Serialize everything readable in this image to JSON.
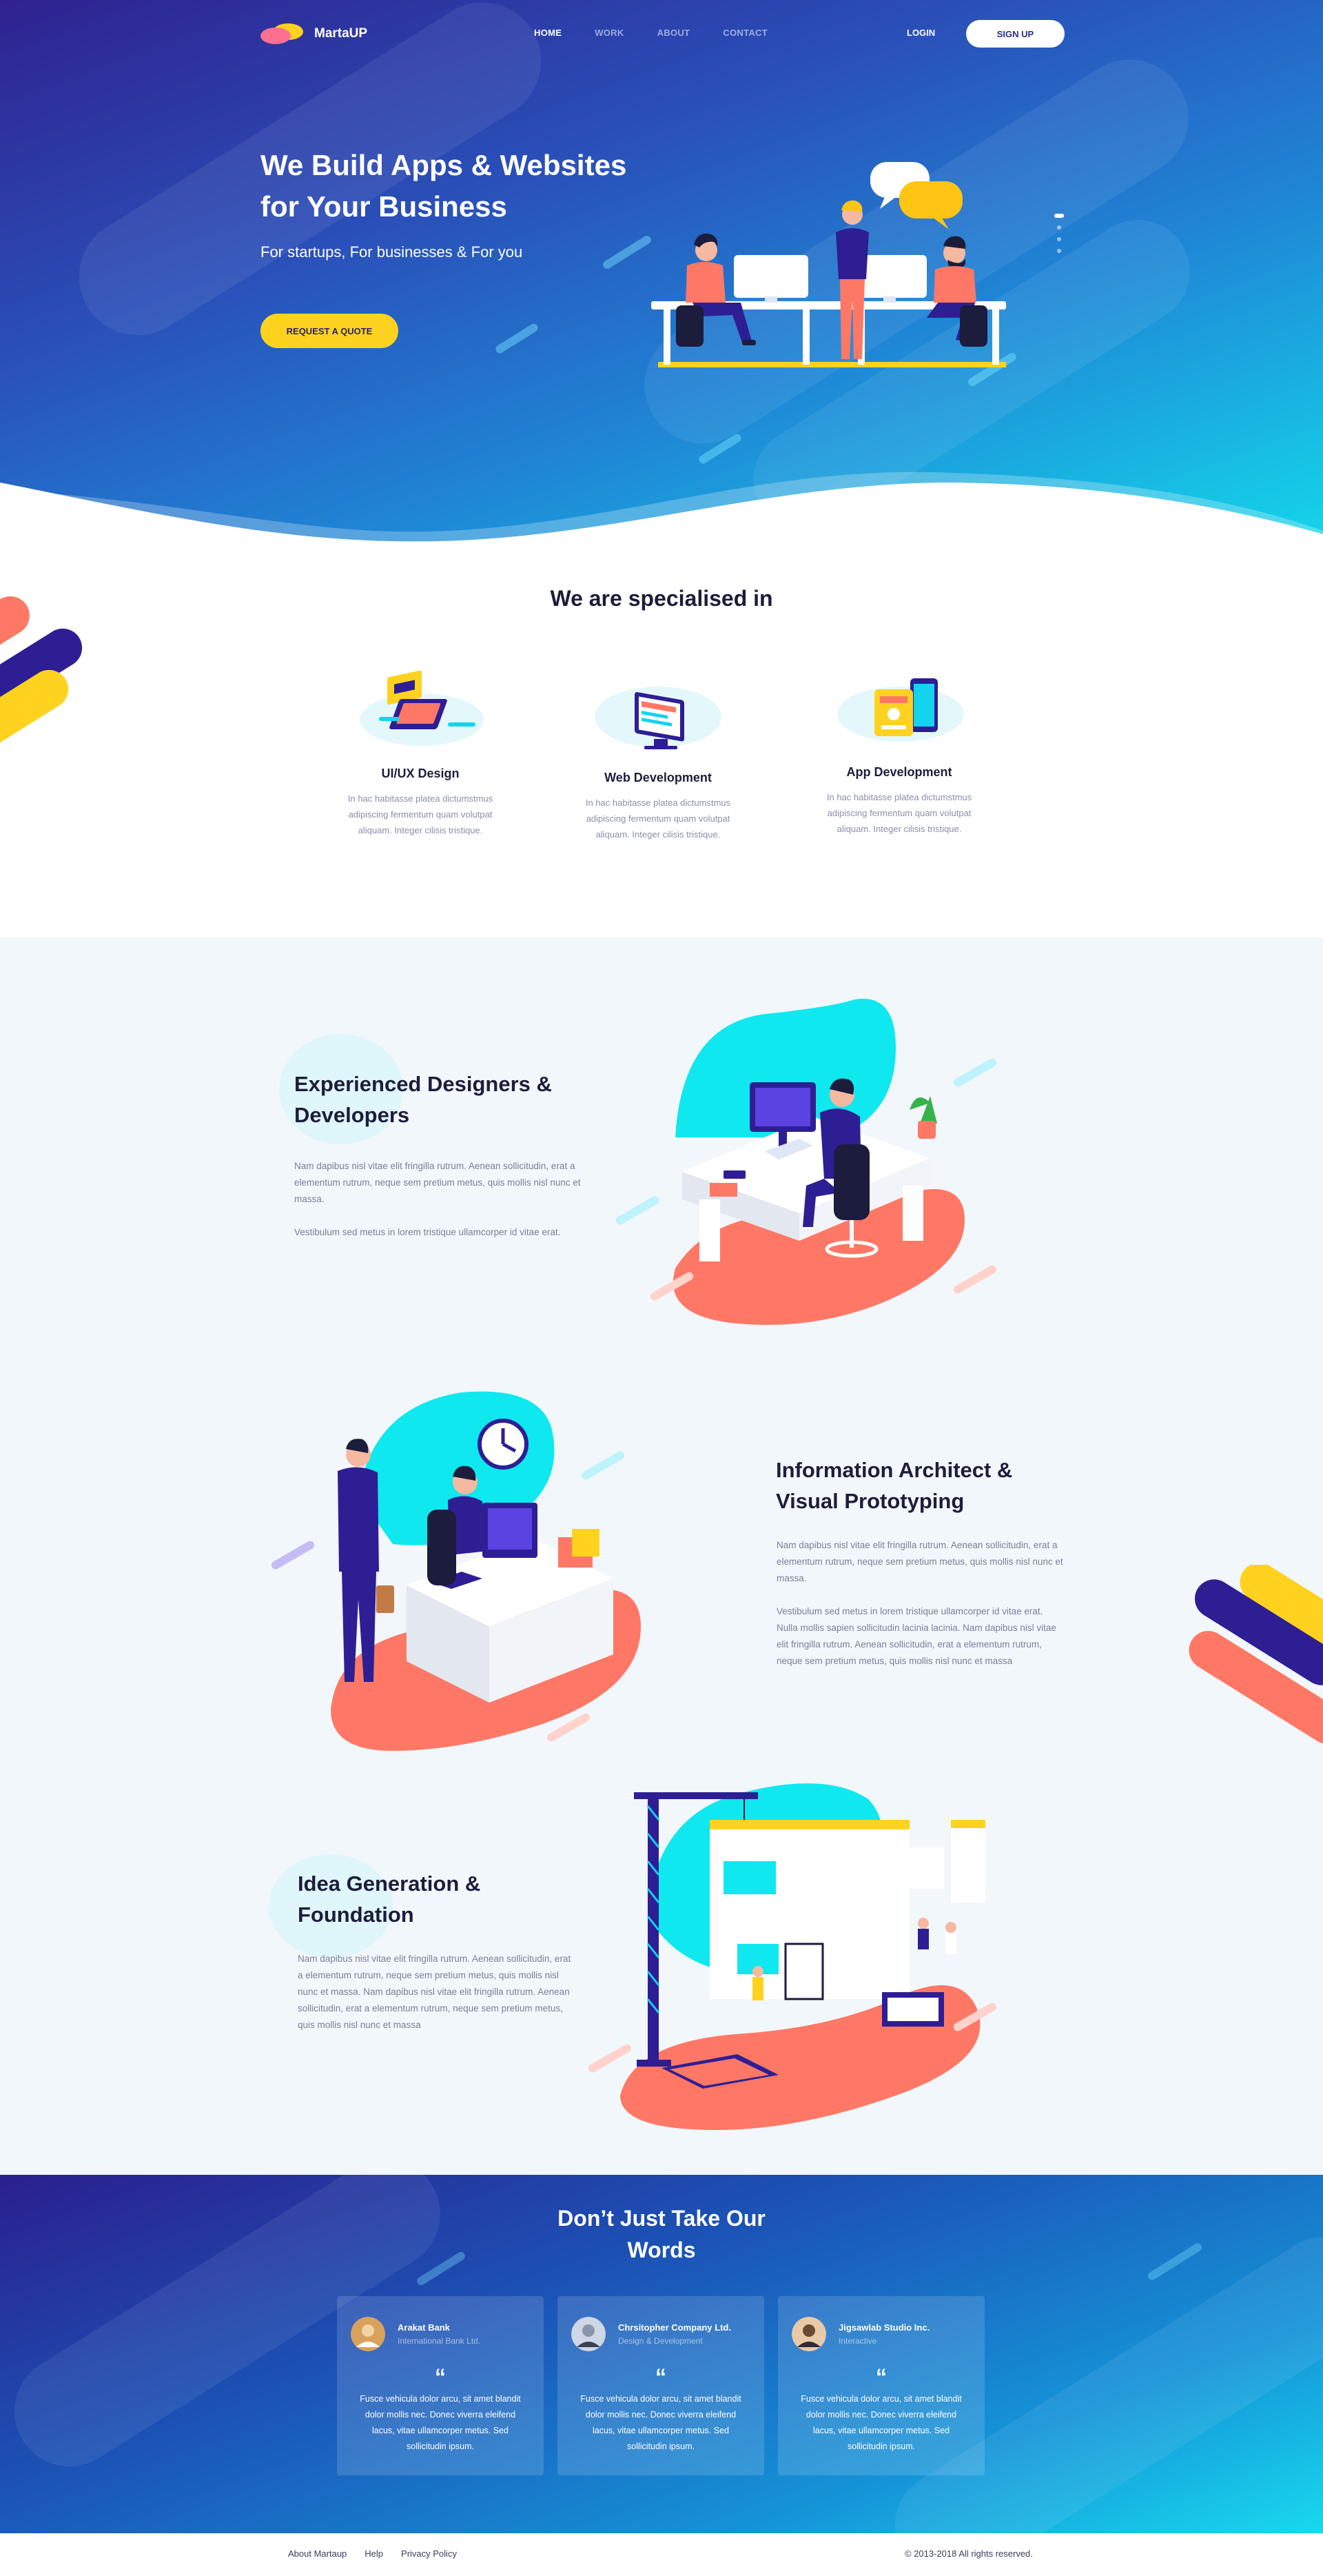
{
  "nav": {
    "logo_text": "MartaUP",
    "links": [
      "HOME",
      "WORK",
      "ABOUT",
      "CONTACT"
    ],
    "login": "LOGIN",
    "signup": "SIGN UP"
  },
  "hero": {
    "title": "We Build Apps & Websites for Your Business",
    "subtitle": "For startups, For businesses & For you",
    "cta": "REQUEST A QUOTE"
  },
  "specialised": {
    "heading": "We are specialised in",
    "services": [
      {
        "title": "UI/UX Design",
        "text": "In hac habitasse platea dictumstmus adipiscing fermentum quam volutpat aliquam. Integer cilisis tristique."
      },
      {
        "title": "Web Development",
        "text": "In hac habitasse platea dictumstmus adipiscing fermentum quam volutpat aliquam. Integer cilisis tristique."
      },
      {
        "title": "App Development",
        "text": "In hac habitasse platea dictumstmus adipiscing fermentum quam volutpat aliquam. Integer cilisis tristique."
      }
    ]
  },
  "features": [
    {
      "title": "Experienced Designers & Developers",
      "paragraphs": [
        "Nam dapibus nisl vitae elit fringilla rutrum. Aenean sollicitudin, erat a elementum rutrum, neque sem pretium metus, quis mollis nisl nunc et massa.",
        "Vestibulum sed metus in lorem tristique ullamcorper id vitae erat."
      ]
    },
    {
      "title": "Information Architect & Visual Prototyping",
      "paragraphs": [
        "Nam dapibus nisl vitae elit fringilla rutrum. Aenean sollicitudin, erat a elementum rutrum, neque sem pretium metus, quis mollis nisl nunc et massa.",
        "Vestibulum sed metus in lorem tristique ullamcorper id vitae erat. Nulla mollis sapien sollicitudin lacinia lacinia. Nam dapibus nisl vitae elit fringilla rutrum. Aenean sollicitudin, erat a elementum rutrum, neque sem pretium metus, quis mollis nisl nunc et massa"
      ]
    },
    {
      "title": "Idea Generation & Foundation",
      "paragraphs": [
        "Nam dapibus nisl vitae elit fringilla rutrum. Aenean sollicitudin, erat a elementum rutrum, neque sem pretium metus, quis mollis nisl nunc et massa. Nam dapibus nisl vitae elit fringilla rutrum. Aenean sollicitudin, erat a elementum rutrum, neque sem pretium metus, quis mollis nisl nunc et massa"
      ]
    }
  ],
  "testimonials": {
    "heading": "Don’t Just Take Our Words",
    "quote_mark": "“",
    "cards": [
      {
        "name": "Arakat Bank",
        "role": "International Bank Ltd.",
        "text": "Fusce vehicula dolor arcu, sit amet blandit dolor mollis nec. Donec viverra eleifend lacus, vitae ullamcorper metus. Sed sollicitudin ipsum."
      },
      {
        "name": "Chrsitopher Company Ltd.",
        "role": "Design & Development",
        "text": "Fusce vehicula dolor arcu, sit amet blandit dolor mollis nec. Donec viverra eleifend lacus, vitae ullamcorper metus. Sed sollicitudin ipsum."
      },
      {
        "name": "Jigsawlab Studio Inc.",
        "role": "Interactive",
        "text": "Fusce vehicula dolor arcu, sit amet blandit dolor mollis nec. Donec viverra eleifend lacus, vitae ullamcorper metus. Sed sollicitudin ipsum."
      }
    ]
  },
  "footer": {
    "links": [
      "About Martaup",
      "Help",
      "Privacy Policy"
    ],
    "copyright": "© 2013-2018 All rights reserved."
  },
  "colors": {
    "accent_yellow": "#ffd21f",
    "accent_cyan": "#14e6ee",
    "accent_coral": "#ff7866",
    "accent_indigo": "#2e1e94",
    "dark_text": "#1d1d3b",
    "muted_text": "#7b7f98"
  }
}
